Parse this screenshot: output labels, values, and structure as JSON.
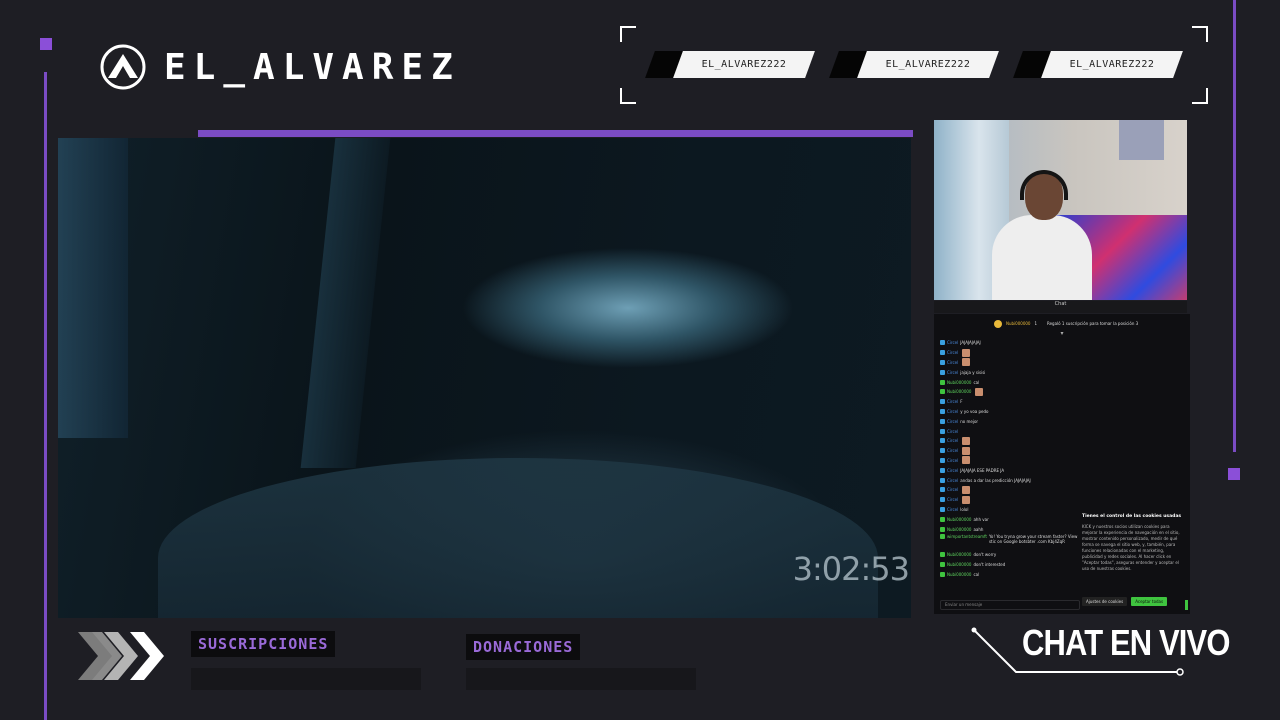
{
  "brand": {
    "name": "EL_ALVAREZ",
    "logo_icon": "mountain-a-logo-icon"
  },
  "tags": [
    {
      "label": "EL_ALVAREZ222"
    },
    {
      "label": "EL_ALVAREZ222"
    },
    {
      "label": "EL_ALVAREZ222"
    }
  ],
  "video": {
    "timestamp": "3:02:53"
  },
  "camera": {
    "label": "Chat"
  },
  "chat": {
    "header_user": "Nubi000000",
    "header_badge": "1",
    "header_text": "Regaló 1 suscripción para tomar la posición 3",
    "messages": [
      {
        "badge": "b",
        "user": "Circel",
        "text": "JAJAJAJAJAJ"
      },
      {
        "badge": "b",
        "user": "Circel",
        "text": "",
        "emote": true
      },
      {
        "badge": "b",
        "user": "Circel",
        "text": "",
        "emote": true
      },
      {
        "badge": "b",
        "user": "Circel",
        "text": "jajaja y sisisi"
      },
      {
        "badge": "g",
        "user": "Nubi000000",
        "text": "cal"
      },
      {
        "badge": "g",
        "user": "Nubi000000",
        "text": "",
        "emote": true
      },
      {
        "badge": "b",
        "user": "Circel",
        "text": "F"
      },
      {
        "badge": "b",
        "user": "Circel",
        "text": "y yo voa pedo"
      },
      {
        "badge": "b",
        "user": "Circel",
        "text": "no mejor"
      },
      {
        "badge": "b",
        "user": "Circel",
        "text": ""
      },
      {
        "badge": "b",
        "user": "Circel",
        "text": "",
        "emote": true
      },
      {
        "badge": "b",
        "user": "Circel",
        "text": "",
        "emote": true
      },
      {
        "badge": "b",
        "user": "Circel",
        "text": "",
        "emote": true
      },
      {
        "badge": "b",
        "user": "Circel",
        "text": "JAJAJAJA ESE PADRE JA"
      },
      {
        "badge": "b",
        "user": "Circel",
        "text": "andas a dar las predicción JAJAJAJAJ"
      },
      {
        "badge": "b",
        "user": "Circel",
        "text": "",
        "emote": true
      },
      {
        "badge": "b",
        "user": "Circel",
        "text": "",
        "emote": true
      },
      {
        "badge": "b",
        "user": "Circel",
        "text": "lolol"
      },
      {
        "badge": "g",
        "user": "Nubi000000",
        "text": "ahh var"
      },
      {
        "badge": "g",
        "user": "Nubi000000",
        "text": "aahh"
      },
      {
        "badge": "g",
        "user": "wimportantstreamft",
        "text": "Yo! You tryna grow your stream faster? View stic on Google botsbter .com Kbj4ZqR",
        "green": true
      },
      {
        "badge": "g",
        "user": "Nubi000000",
        "text": "don't worry"
      },
      {
        "badge": "g",
        "user": "Nubi000000",
        "text": "don't interested"
      },
      {
        "badge": "g",
        "user": "Nubi000000",
        "text": "cal"
      }
    ],
    "input_placeholder": "Enviar un mensaje",
    "cookie": {
      "title": "Tienes el control de las cookies usadas",
      "body": "KICK y nuestros socios utilizan cookies para mejorar la experiencia de navegación en el sitio, mostrar contenido personalizado, medir de qué forma se navega el sitio web, y, también, para funciones relacionadas con el marketing, publicidad y redes sociales. Al hacer click en \"Aceptar todas\", aseguras entender y aceptar el uso de nuestras cookies.",
      "settings_label": "Ajustes de cookies",
      "accept_label": "Aceptar todas"
    }
  },
  "footer": {
    "subs_label": "SUSCRIPCIONES",
    "subs_value": "",
    "donations_label": "DONACIONES",
    "donations_value": "",
    "chat_live": "CHAT EN VIVO"
  },
  "colors": {
    "accent": "#7b4cc4",
    "background": "#1e1e24",
    "label": "#9a6ad8"
  }
}
